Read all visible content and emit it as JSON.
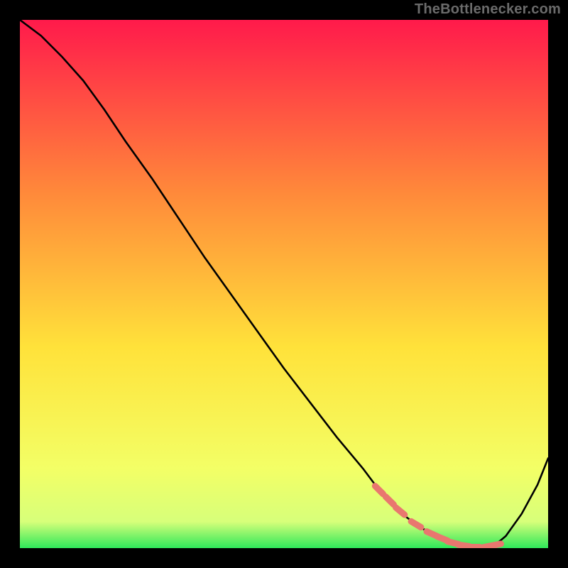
{
  "watermark": "TheBottlenecker.com",
  "colors": {
    "bg": "#000000",
    "grad_top": "#ff1a4b",
    "grad_mid_up": "#ff8a3a",
    "grad_mid": "#ffe23a",
    "grad_low": "#f3ff66",
    "grad_green": "#2fe85a",
    "curve": "#000000",
    "marker": "#e9776f"
  },
  "chart_data": {
    "type": "line",
    "title": "",
    "xlabel": "",
    "ylabel": "",
    "xlim": [
      0,
      100
    ],
    "ylim": [
      0,
      100
    ],
    "curve": {
      "x": [
        0,
        4,
        8,
        12,
        16,
        20,
        25,
        30,
        35,
        40,
        45,
        50,
        55,
        60,
        65,
        68,
        70,
        73,
        76,
        80,
        84,
        86,
        88,
        90,
        92,
        95,
        98,
        100
      ],
      "y": [
        100,
        97,
        93,
        88.5,
        83,
        77,
        70,
        62.5,
        55,
        48,
        41,
        34,
        27.5,
        21,
        15,
        11,
        9,
        6,
        3.8,
        1.8,
        0.5,
        0.2,
        0.2,
        0.6,
        2.3,
        6.5,
        12,
        17
      ]
    },
    "markers": {
      "x": [
        68,
        70,
        72,
        75,
        78,
        80,
        82,
        84,
        86,
        88,
        89,
        90
      ],
      "y": [
        11,
        9,
        7,
        4.5,
        2.7,
        1.8,
        1.0,
        0.5,
        0.2,
        0.2,
        0.4,
        0.6
      ]
    }
  }
}
